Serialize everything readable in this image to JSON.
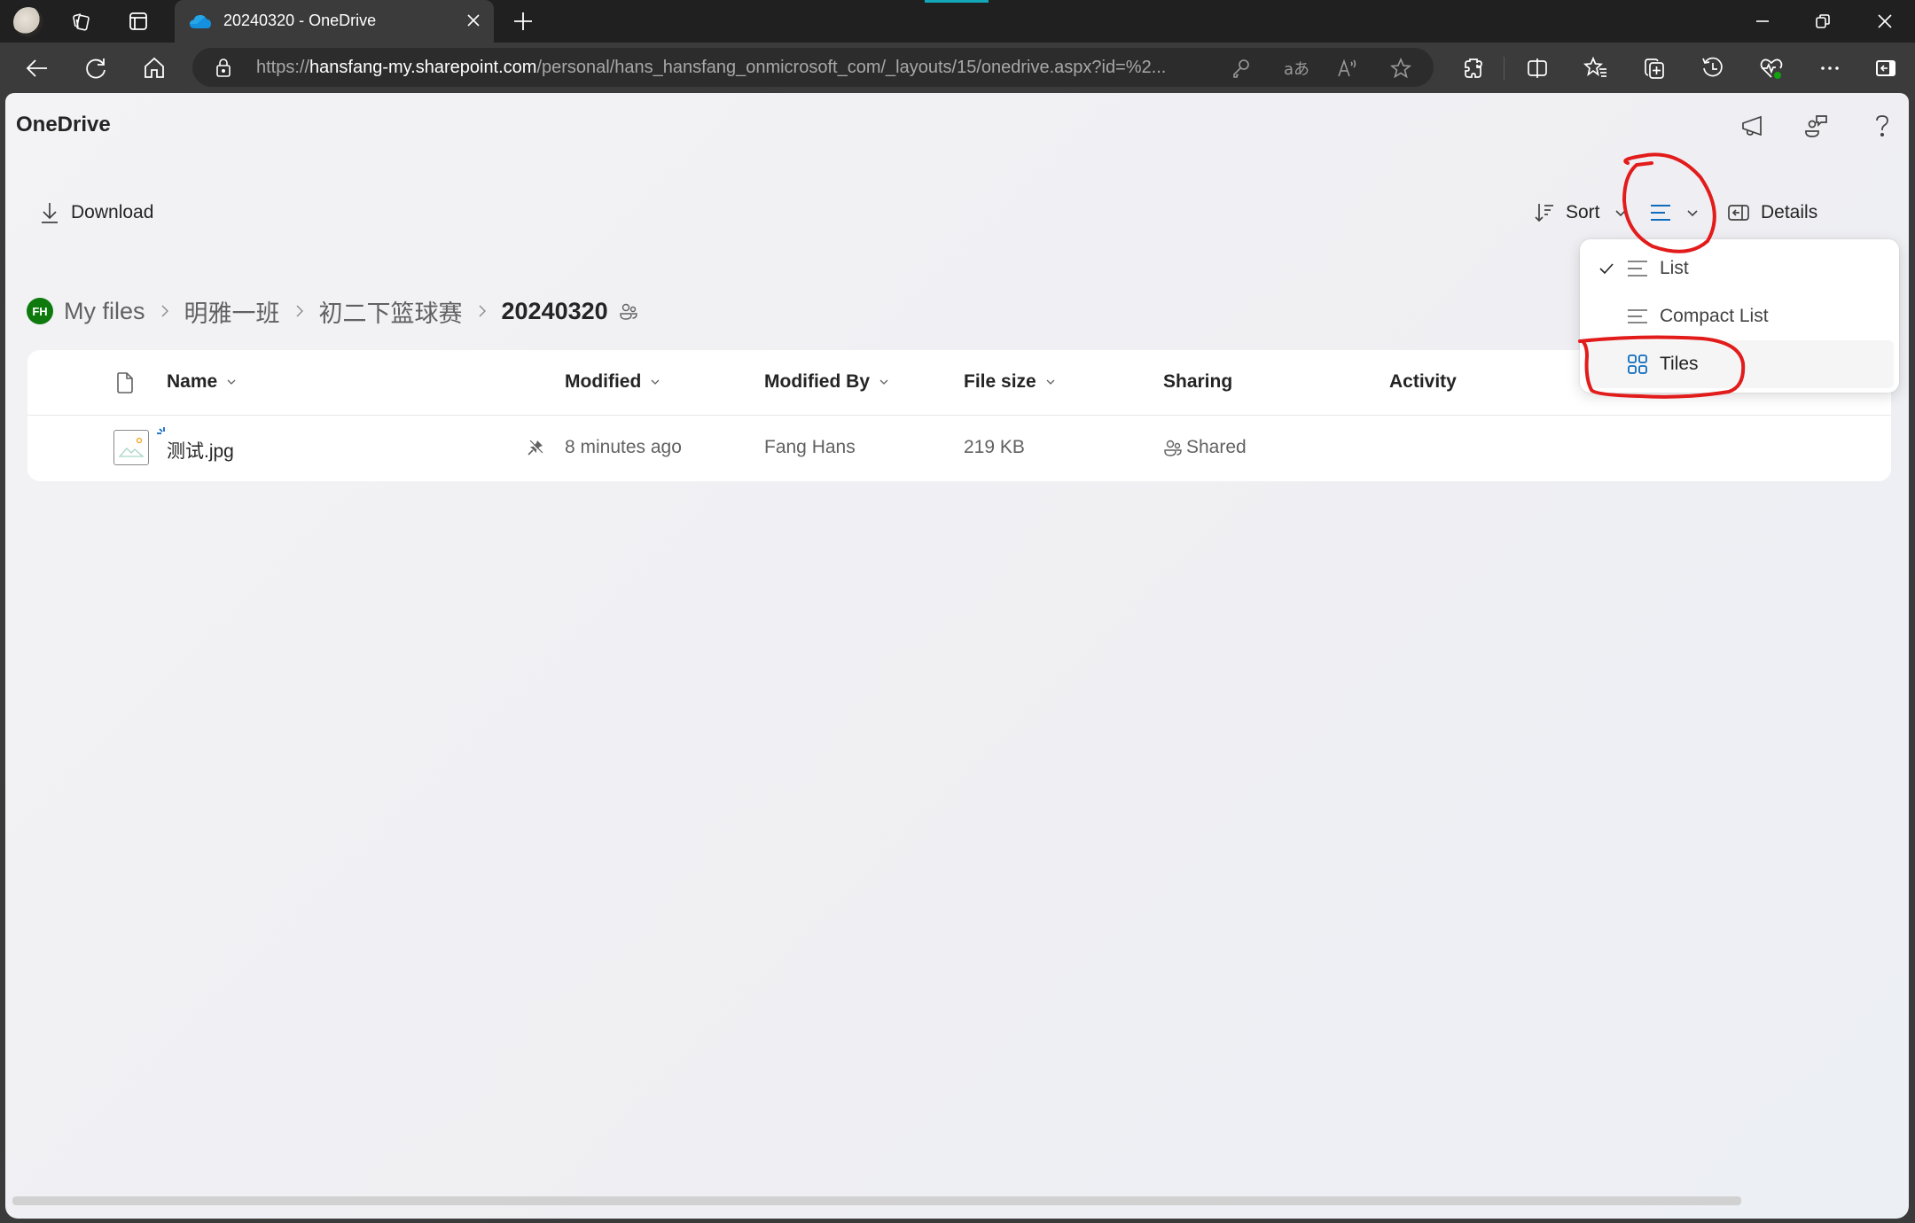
{
  "browser": {
    "tab": {
      "title": "20240320 - OneDrive",
      "icon": "onedrive-cloud-icon"
    },
    "address_bar": {
      "url_prefix": "https://",
      "url_domain": "hansfang-my.sharepoint.com",
      "url_path": "/personal/hans_hansfang_onmicrosoft_com/_layouts/15/onedrive.aspx?id=%2..."
    },
    "colors": {
      "tabbar": "#202020",
      "toolbar": "#3b3b3b",
      "accent_teal": "#12a8b8"
    }
  },
  "app": {
    "title": "OneDrive",
    "header_icons": [
      "megaphone-icon",
      "people-chat-icon",
      "help-icon"
    ],
    "help_glyph": "?"
  },
  "commands": {
    "download": "Download",
    "sort": "Sort",
    "details": "Details"
  },
  "breadcrumb": {
    "avatar_initials": "FH",
    "items": [
      "My files",
      "明雅一班",
      "初二下篮球赛"
    ],
    "current": "20240320"
  },
  "table": {
    "columns": [
      "Name",
      "Modified",
      "Modified By",
      "File size",
      "Sharing",
      "Activity"
    ],
    "rows": [
      {
        "name": "测试.jpg",
        "modified": "8 minutes ago",
        "modified_by": "Fang Hans",
        "file_size": "219 KB",
        "sharing": "Shared",
        "activity": ""
      }
    ]
  },
  "view_menu": {
    "items": [
      {
        "label": "List",
        "checked": true
      },
      {
        "label": "Compact List",
        "checked": false
      },
      {
        "label": "Tiles",
        "checked": false,
        "hovered": true
      }
    ]
  },
  "colors": {
    "brand_blue": "#0f6cbd",
    "avatar_green": "#0e7a0d",
    "annotation_red": "#e21b1b"
  }
}
